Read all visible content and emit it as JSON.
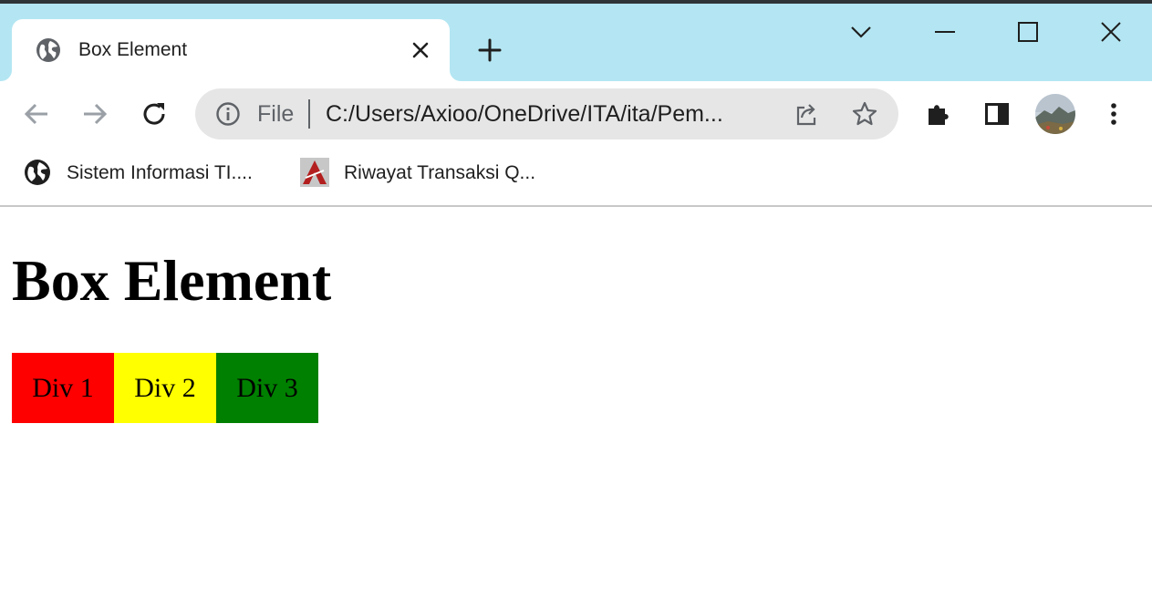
{
  "tab": {
    "title": "Box Element",
    "icon": "globe-icon"
  },
  "window_controls": [
    "tab-search-icon",
    "minimize-icon",
    "maximize-icon",
    "close-icon"
  ],
  "toolbar": {
    "back_icon": "arrow-left-icon",
    "forward_icon": "arrow-right-icon",
    "reload_icon": "reload-icon"
  },
  "omnibox": {
    "scheme_label": "File",
    "url": "C:/Users/Axioo/OneDrive/ITA/ita/Pem..."
  },
  "bookmarks": [
    {
      "label": "Sistem Informasi TI....",
      "icon": "globe-icon"
    },
    {
      "label": "Riwayat Transaksi Q...",
      "icon": "site-favicon"
    }
  ],
  "page": {
    "heading": "Box Element",
    "boxes": [
      {
        "label": "Div 1",
        "color": "#ff0000"
      },
      {
        "label": "Div 2",
        "color": "#ffff00"
      },
      {
        "label": "Div 3",
        "color": "#008000"
      }
    ]
  },
  "colors": {
    "titlebar": "#b3e6f2",
    "omnibox": "#e6e6e6"
  }
}
